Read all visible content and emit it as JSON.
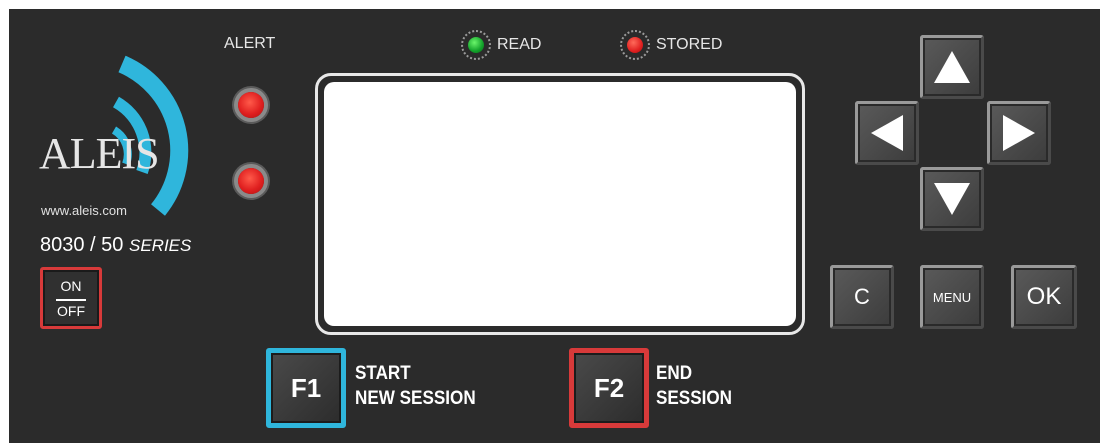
{
  "device": {
    "logo_text": "ALEIS",
    "website": "www.aleis.com",
    "model_number": "8030 / 50",
    "model_series": "SERIES",
    "accent_colors": {
      "brand_cyan": "#2fb6dc",
      "alert_red": "#e02020",
      "read_green": "#12a12a"
    }
  },
  "power": {
    "on_label": "ON",
    "off_label": "OFF"
  },
  "alert": {
    "label": "ALERT"
  },
  "status_leds": {
    "read_label": "READ",
    "read_color": "green",
    "stored_label": "STORED",
    "stored_color": "red"
  },
  "keypad": {
    "up_icon": "arrow-up-icon",
    "down_icon": "arrow-down-icon",
    "left_icon": "arrow-left-icon",
    "right_icon": "arrow-right-icon",
    "clear_label": "C",
    "menu_label": "MENU",
    "ok_label": "OK"
  },
  "function_keys": {
    "f1_label": "F1",
    "f1_caption_line1": "START",
    "f1_caption_line2": "NEW SESSION",
    "f2_label": "F2",
    "f2_caption_line1": "END",
    "f2_caption_line2": "SESSION"
  }
}
